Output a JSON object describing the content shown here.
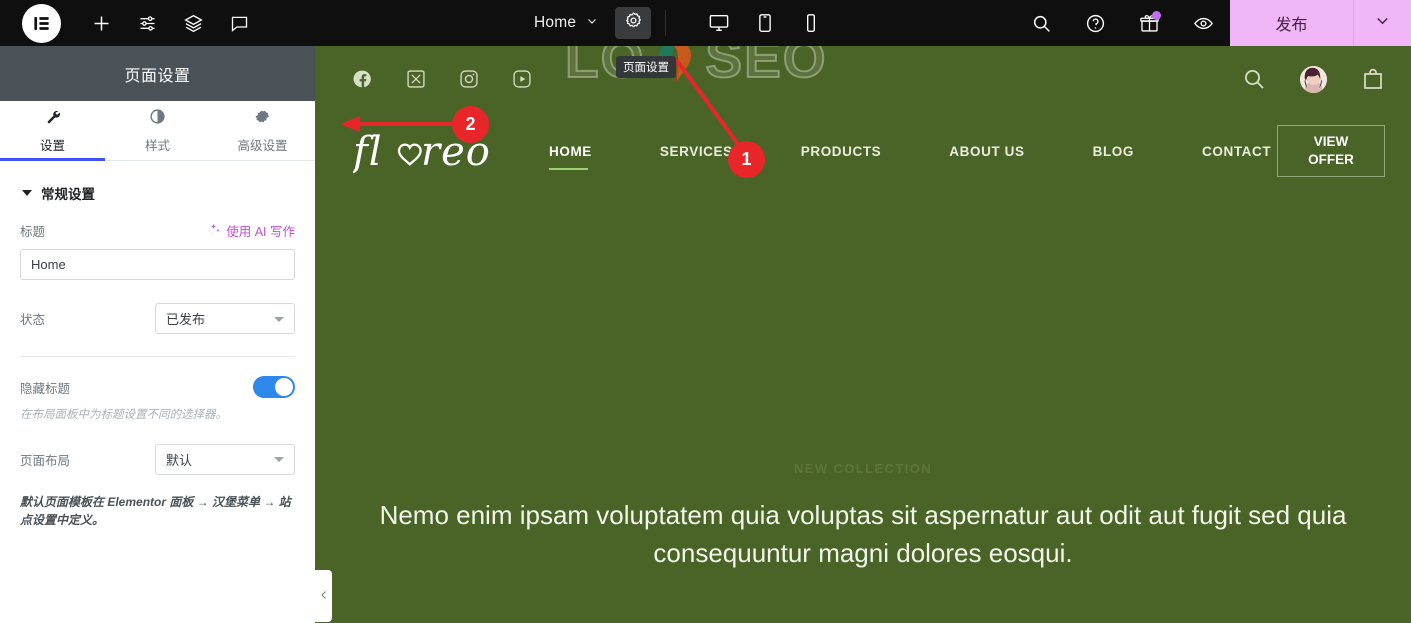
{
  "toolbar": {
    "logo_label": "E",
    "icons": [
      {
        "name": "add-element-icon",
        "label": "+"
      },
      {
        "name": "settings-sliders-icon",
        "label": "sliders"
      },
      {
        "name": "navigator-layers-icon",
        "label": "layers"
      },
      {
        "name": "comments-icon",
        "label": "comment"
      }
    ],
    "document_name": "Home",
    "page_settings_icon": "gear-icon",
    "devices": [
      "desktop-icon",
      "tablet-icon",
      "mobile-icon"
    ],
    "right_icons": [
      "search-icon",
      "help-icon",
      "gift-icon",
      "preview-eye-icon"
    ],
    "publish_label": "发布",
    "publish_caret": "chevron-down-icon",
    "publish_bg": "#f0b6f7"
  },
  "tooltip": {
    "text": "页面设置"
  },
  "panel": {
    "header_title": "页面设置",
    "tabs": [
      {
        "label": "设置",
        "icon": "wrench-icon",
        "active": true
      },
      {
        "label": "样式",
        "icon": "contrast-icon",
        "active": false
      },
      {
        "label": "高级设置",
        "icon": "gear-icon",
        "active": false
      }
    ],
    "section_title": "常规设置",
    "title_field": {
      "label": "标题",
      "ai_link": "使用 AI 写作",
      "value": "Home",
      "placeholder": "Home"
    },
    "status_field": {
      "label": "状态",
      "value": "已发布"
    },
    "hide_title_field": {
      "label": "隐藏标题",
      "toggle_on": true,
      "hint": "在布局面板中为标题设置不同的选择器。"
    },
    "page_layout_field": {
      "label": "页面布局",
      "value": "默认"
    },
    "footer_hint": "默认页面模板在 Elementor 面板 → 汉堡菜单 → 站点设置中定义。",
    "collapse_icon": "chevron-left-icon",
    "header_bg": "#4a5258",
    "accent": "#3f51f4"
  },
  "site": {
    "background": "#4a6428",
    "social": [
      "facebook-icon",
      "x-twitter-icon",
      "instagram-icon",
      "youtube-icon"
    ],
    "topbar_right": [
      "search-icon",
      "account-avatar",
      "cart-bag-icon"
    ],
    "brand": "floreo",
    "nav": [
      {
        "label": "HOME",
        "active": true
      },
      {
        "label": "SERVICES",
        "active": false
      },
      {
        "label": "PRODUCTS",
        "active": false
      },
      {
        "label": "ABOUT US",
        "active": false
      },
      {
        "label": "BLOG",
        "active": false
      },
      {
        "label": "CONTACT",
        "active": false
      }
    ],
    "cta": {
      "line1": "VIEW",
      "line2": "OFFER"
    },
    "hero": {
      "eyebrow": "NEW COLLECTION",
      "text": "Nemo enim ipsam voluptatem quia voluptas sit aspernatur aut odit aut fugit sed quia consequuntur magni dolores eosqui."
    }
  },
  "watermark": {
    "left_text": "LO",
    "right_text": "SEO"
  },
  "annotations": [
    {
      "id": "1",
      "label": "1",
      "color": "#e8262a"
    },
    {
      "id": "2",
      "label": "2",
      "color": "#e8262a"
    }
  ]
}
